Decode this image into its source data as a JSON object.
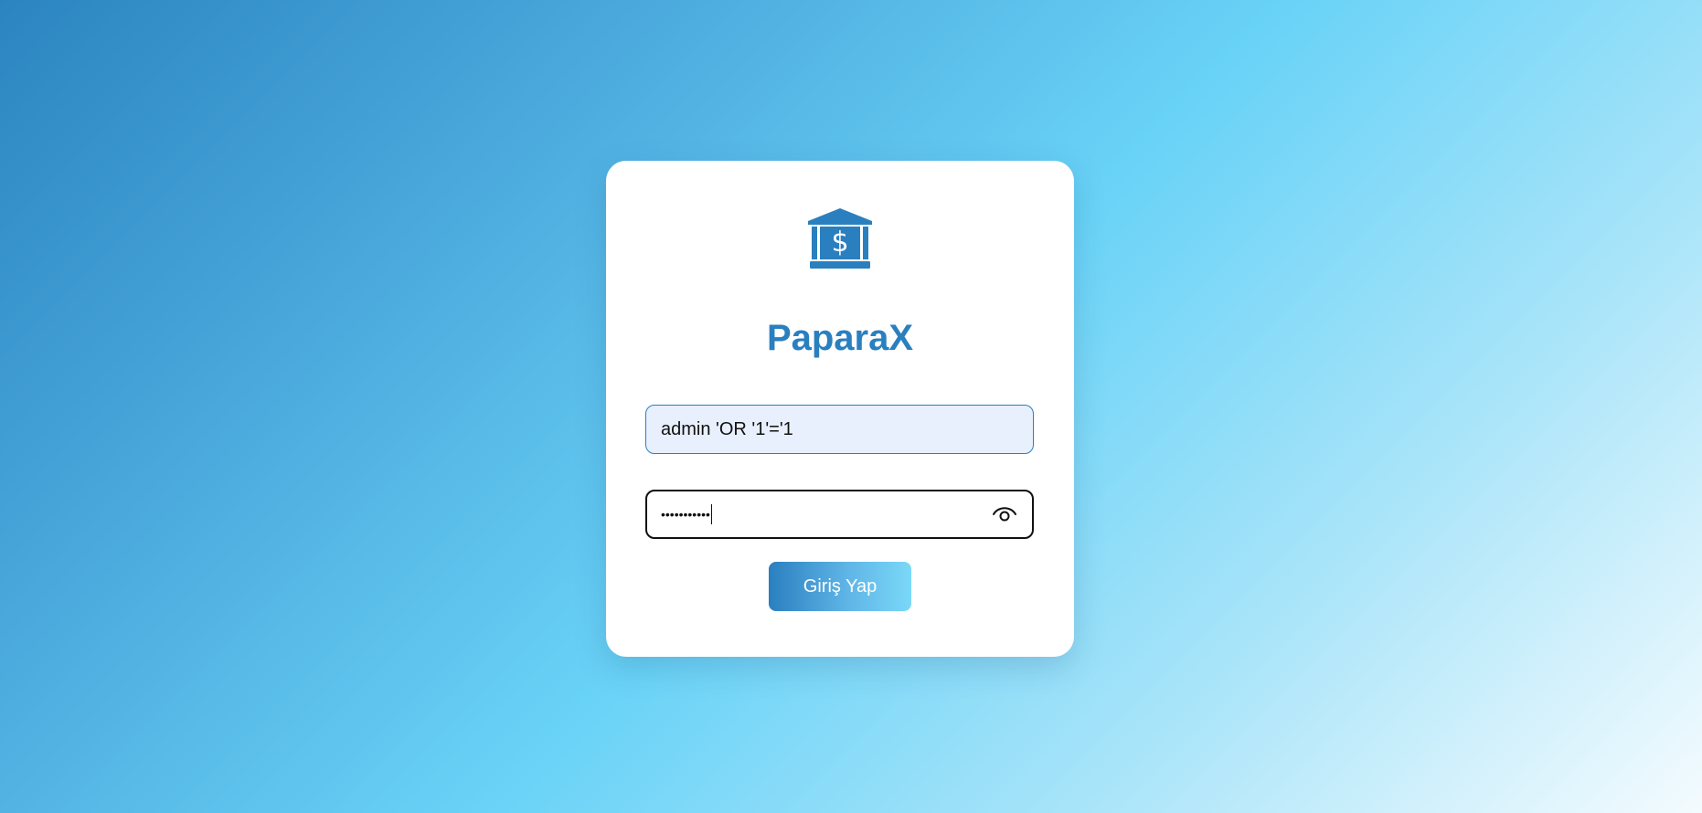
{
  "app": {
    "logo_icon": "bank-dollar-icon",
    "title": "PaparaX",
    "brand_color": "#2a7fbf"
  },
  "login_form": {
    "username_value": "admin 'OR '1'='1",
    "password_masked": "•••••••••••",
    "password_toggle_icon": "eye-icon",
    "submit_label": "Giriş Yap"
  }
}
